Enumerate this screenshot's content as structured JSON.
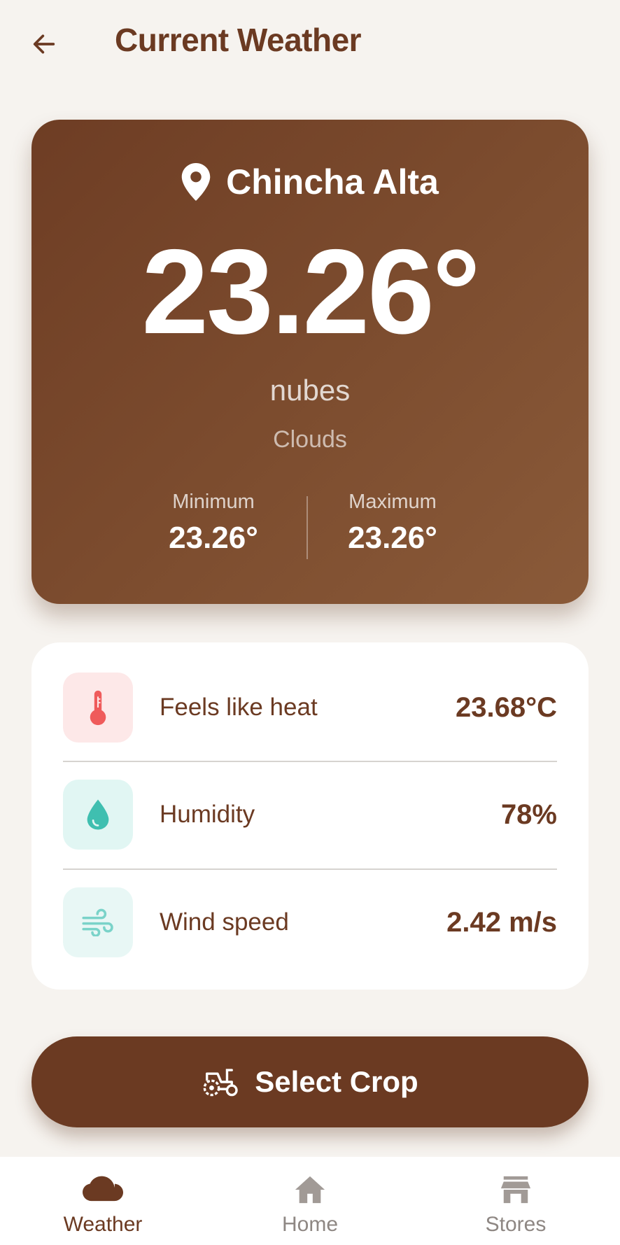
{
  "header": {
    "back_icon": "arrow-left-icon",
    "title": "Current Weather"
  },
  "weather": {
    "location_icon": "map-pin-icon",
    "location": "Chincha Alta",
    "temperature": "23.26°",
    "description_es": "nubes",
    "description_en": "Clouds",
    "min_label": "Minimum",
    "min_value": "23.26°",
    "max_label": "Maximum",
    "max_value": "23.26°"
  },
  "details": [
    {
      "icon": "thermometer-icon",
      "label": "Feels like heat",
      "value": "23.68°C"
    },
    {
      "icon": "water-drop-icon",
      "label": "Humidity",
      "value": "78%"
    },
    {
      "icon": "wind-icon",
      "label": "Wind speed",
      "value": "2.42 m/s"
    }
  ],
  "action": {
    "icon": "tractor-icon",
    "label": "Select Crop"
  },
  "bottom_nav": [
    {
      "icon": "cloud-icon",
      "label": "Weather",
      "active": true
    },
    {
      "icon": "home-icon",
      "label": "Home",
      "active": false
    },
    {
      "icon": "store-icon",
      "label": "Stores",
      "active": false
    }
  ],
  "colors": {
    "brand": "#6b3a22",
    "background": "#f6f3ef",
    "thermometer": "#ef5b5b",
    "humidity": "#3fbfb0",
    "wind": "#7ad3c9"
  }
}
